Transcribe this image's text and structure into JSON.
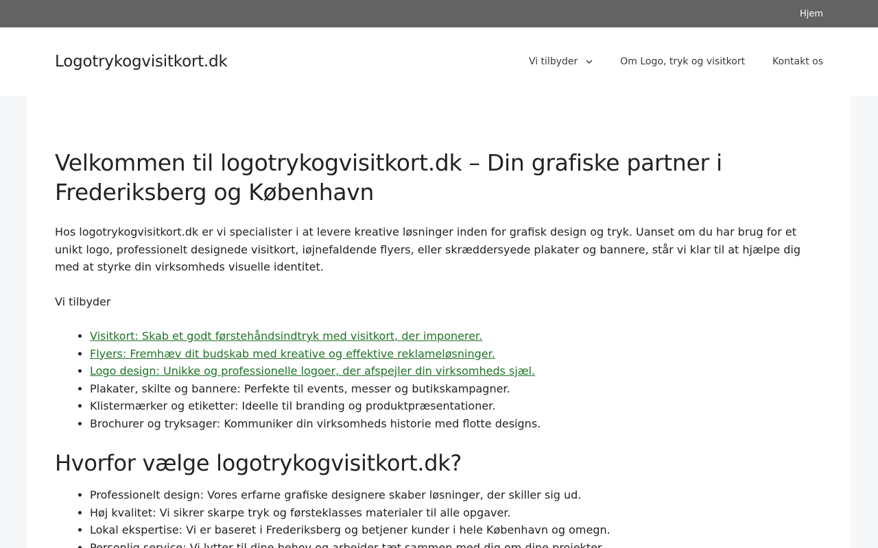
{
  "topbar": {
    "home_label": "Hjem"
  },
  "header": {
    "site_title": "Logotrykogvisitkort.dk",
    "nav": [
      {
        "label": "Vi tilbyder",
        "has_dropdown": true
      },
      {
        "label": "Om Logo, tryk og visitkort"
      },
      {
        "label": "Kontakt os"
      }
    ]
  },
  "main": {
    "title": "Velkommen til logotrykogvisitkort.dk – Din grafiske partner i Frederiksberg og København",
    "intro": "Hos logotrykogvisitkort.dk er vi specialister i at levere kreative løsninger inden for grafisk design og tryk. Uanset om du har brug for et unikt logo, professionelt designede visitkort, iøjnefaldende flyers, eller skræddersyede plakater og bannere, står vi klar til at hjælpe dig med at styrke din virksomheds visuelle identitet.",
    "offer_heading": "Vi tilbyder",
    "offer_links": [
      "Visitkort: Skab et godt førstehåndsindtryk med visitkort, der imponerer.",
      "Flyers: Fremhæv dit budskab med kreative og effektive reklameløsninger.",
      "Logo design: Unikke og professionelle logoer, der afspejler din virksomheds sjæl."
    ],
    "offer_items": [
      "Plakater, skilte og bannere: Perfekte til events, messer og butikskampagner.",
      "Klistermærker og etiketter: Ideelle til branding og produktpræsentationer.",
      "Brochurer og tryksager: Kommuniker din virksomheds historie med flotte designs."
    ],
    "why_heading": "Hvorfor vælge logotrykogvisitkort.dk?",
    "why_items": [
      "Professionelt design: Vores erfarne grafiske designere skaber løsninger, der skiller sig ud.",
      "Høj kvalitet: Vi sikrer skarpe tryk og førsteklasses materialer til alle opgaver.",
      "Lokal ekspertise: Vi er baseret i Frederiksberg og betjener kunder i hele København og omegn.",
      "Personlig service: Vi lytter til dine behov og arbejder tæt sammen med dig om dine projekter."
    ]
  },
  "colors": {
    "topbar": "#636363",
    "link": "#1e7325",
    "background": "#f6f7f8"
  }
}
